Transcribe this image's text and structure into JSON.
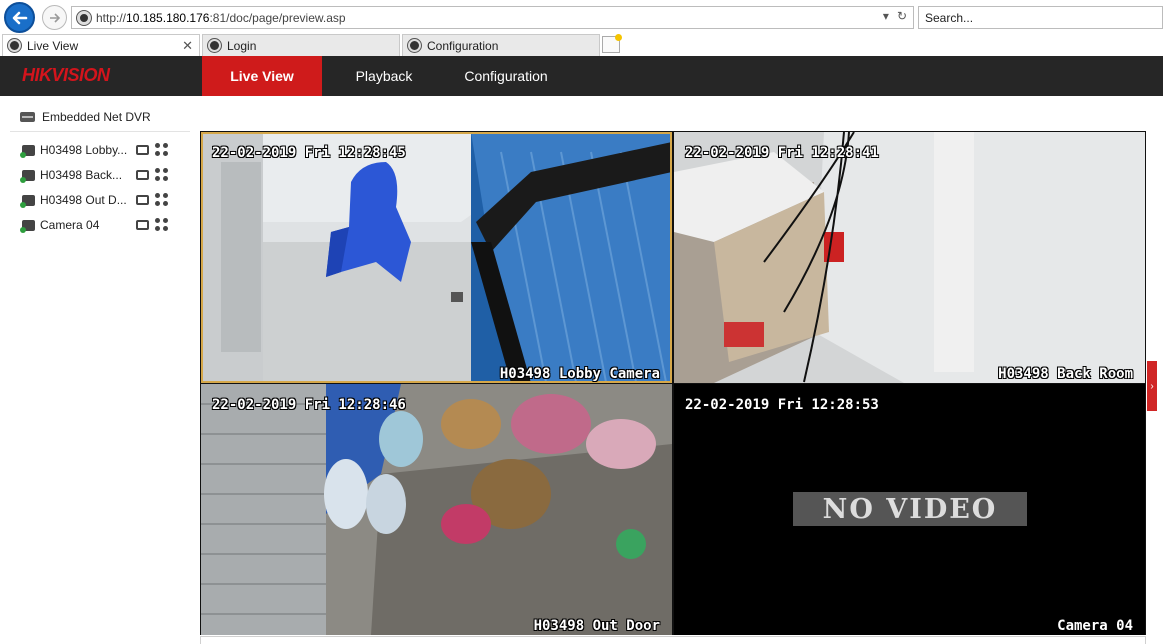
{
  "browser": {
    "url_prefix": "http://",
    "url_host": "10.185.180.176",
    "url_rest": ":81/doc/page/preview.asp",
    "search_placeholder": "Search...",
    "tabs": [
      {
        "label": "Live View"
      },
      {
        "label": "Login"
      },
      {
        "label": "Configuration"
      }
    ]
  },
  "header": {
    "logo": "HIKVISION",
    "menu": [
      {
        "label": "Live View",
        "active": true
      },
      {
        "label": "Playback",
        "active": false
      },
      {
        "label": "Configuration",
        "active": false
      }
    ]
  },
  "sidebar": {
    "device": "Embedded Net DVR",
    "cameras": [
      {
        "label": "H03498 Lobby..."
      },
      {
        "label": "H03498 Back..."
      },
      {
        "label": "H03498 Out D..."
      },
      {
        "label": "Camera 04"
      }
    ]
  },
  "video": {
    "tiles": [
      {
        "timestamp": "22-02-2019 Fri 12:28:45",
        "name": "H03498 Lobby Camera"
      },
      {
        "timestamp": "22-02-2019 Fri 12:28:41",
        "name": "H03498 Back Room"
      },
      {
        "timestamp": "22-02-2019 Fri 12:28:46",
        "name": "H03498 Out Door"
      },
      {
        "timestamp": "22-02-2019 Fri 12:28:53",
        "name": "Camera 04",
        "status": "NO VIDEO"
      }
    ]
  },
  "colors": {
    "brand": "#d3141c",
    "active_tab": "#cf1b1b",
    "header_bg": "#262626"
  }
}
